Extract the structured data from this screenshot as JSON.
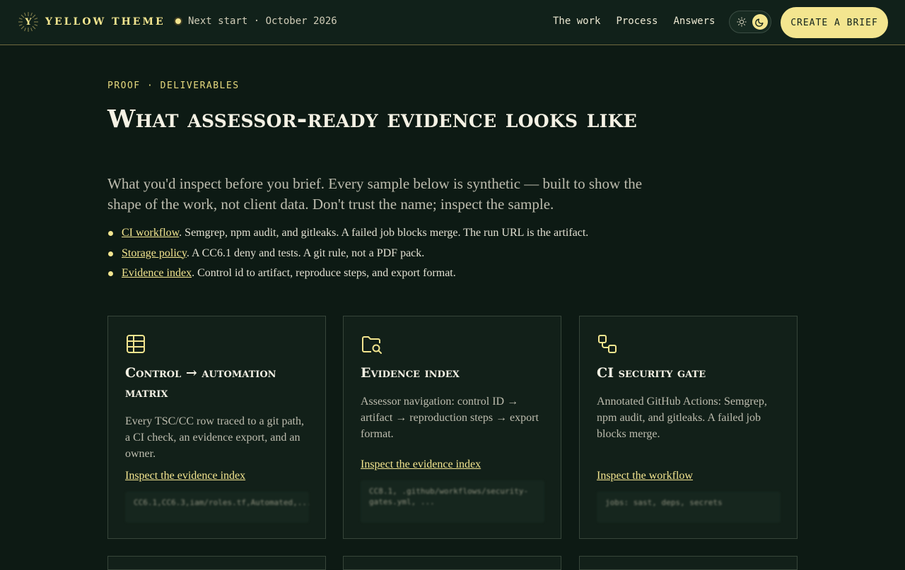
{
  "brand": {
    "name": "YELLOW THEME",
    "mark_letter": "Y"
  },
  "status": {
    "text": "Next start · October 2026"
  },
  "nav": {
    "items": [
      {
        "label": "The work"
      },
      {
        "label": "Process"
      },
      {
        "label": "Answers"
      }
    ]
  },
  "cta": {
    "label": "CREATE A BRIEF"
  },
  "hero": {
    "eyebrow": "PROOF · DELIVERABLES",
    "title": "What assessor-ready evidence looks like",
    "lede": "What you'd inspect before you brief. Every sample below is synthetic — built to show the shape of the work, not client data. Don't trust the name; inspect the sample."
  },
  "bullets": [
    {
      "link": "CI workflow",
      "text": ". Semgrep, npm audit, and gitleaks. A failed job blocks merge. The run URL is the artifact."
    },
    {
      "link": "Storage policy",
      "text": ". A CC6.1 deny and tests. A git rule, not a PDF pack."
    },
    {
      "link": "Evidence index",
      "text": ". Control id to artifact, reproduce steps, and export format."
    }
  ],
  "cards": [
    {
      "icon": "table-icon",
      "title": "Control → automation matrix",
      "body": "Every TSC/CC row traced to a git path, a CI check, an evidence export, and an owner.",
      "link": "Inspect the evidence index",
      "code": "CC6.1,CC6.3,iam/roles.tf,Automated,..."
    },
    {
      "icon": "folder-search-icon",
      "title": "Evidence index",
      "body": "Assessor navigation: control ID → artifact → reproduction steps → export format.",
      "link": "Inspect the evidence index",
      "code": "CC8.1, .github/workflows/security-gates.yml, ..."
    },
    {
      "icon": "workflow-icon",
      "title": "CI security gate",
      "body": "Annotated GitHub Actions: Semgrep, npm audit, and gitleaks. A failed job blocks merge.",
      "link": "Inspect the workflow",
      "code": "jobs: sast, deps, secrets"
    }
  ],
  "colors": {
    "accent": "#f3e58f",
    "background": "#0d1a14",
    "card": "#122019"
  }
}
